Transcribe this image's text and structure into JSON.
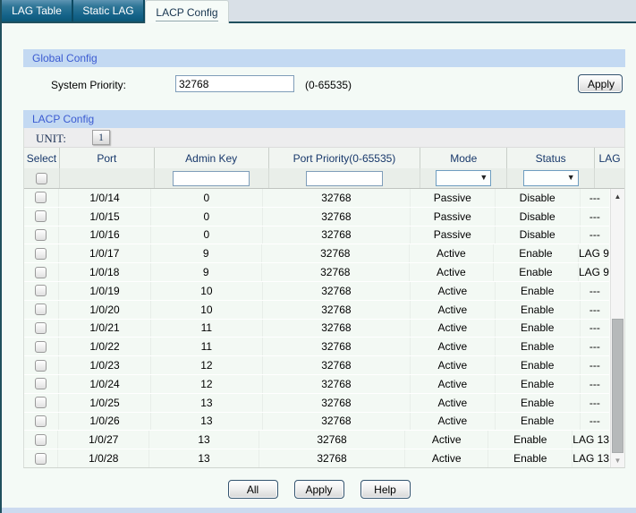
{
  "tabs": [
    {
      "label": "LAG Table",
      "active": false
    },
    {
      "label": "Static LAG",
      "active": false
    },
    {
      "label": "LACP Config",
      "active": true
    }
  ],
  "global_config": {
    "title": "Global Config",
    "system_priority_label": "System Priority:",
    "system_priority_value": "32768",
    "system_priority_hint": "(0-65535)",
    "apply_label": "Apply"
  },
  "lacp_config": {
    "title": "LACP Config",
    "unit_label": "UNIT:",
    "unit_value": "1",
    "columns": [
      "Select",
      "Port",
      "Admin Key",
      "Port Priority(0-65535)",
      "Mode",
      "Status",
      "LAG"
    ],
    "filter": {
      "admin_key": "",
      "port_priority": "",
      "mode": "",
      "status": ""
    },
    "rows": [
      {
        "port": "1/0/14",
        "admin_key": "0",
        "port_priority": "32768",
        "mode": "Passive",
        "status": "Disable",
        "lag": "---"
      },
      {
        "port": "1/0/15",
        "admin_key": "0",
        "port_priority": "32768",
        "mode": "Passive",
        "status": "Disable",
        "lag": "---"
      },
      {
        "port": "1/0/16",
        "admin_key": "0",
        "port_priority": "32768",
        "mode": "Passive",
        "status": "Disable",
        "lag": "---"
      },
      {
        "port": "1/0/17",
        "admin_key": "9",
        "port_priority": "32768",
        "mode": "Active",
        "status": "Enable",
        "lag": "LAG 9"
      },
      {
        "port": "1/0/18",
        "admin_key": "9",
        "port_priority": "32768",
        "mode": "Active",
        "status": "Enable",
        "lag": "LAG 9"
      },
      {
        "port": "1/0/19",
        "admin_key": "10",
        "port_priority": "32768",
        "mode": "Active",
        "status": "Enable",
        "lag": "---"
      },
      {
        "port": "1/0/20",
        "admin_key": "10",
        "port_priority": "32768",
        "mode": "Active",
        "status": "Enable",
        "lag": "---"
      },
      {
        "port": "1/0/21",
        "admin_key": "11",
        "port_priority": "32768",
        "mode": "Active",
        "status": "Enable",
        "lag": "---"
      },
      {
        "port": "1/0/22",
        "admin_key": "11",
        "port_priority": "32768",
        "mode": "Active",
        "status": "Enable",
        "lag": "---"
      },
      {
        "port": "1/0/23",
        "admin_key": "12",
        "port_priority": "32768",
        "mode": "Active",
        "status": "Enable",
        "lag": "---"
      },
      {
        "port": "1/0/24",
        "admin_key": "12",
        "port_priority": "32768",
        "mode": "Active",
        "status": "Enable",
        "lag": "---"
      },
      {
        "port": "1/0/25",
        "admin_key": "13",
        "port_priority": "32768",
        "mode": "Active",
        "status": "Enable",
        "lag": "---"
      },
      {
        "port": "1/0/26",
        "admin_key": "13",
        "port_priority": "32768",
        "mode": "Active",
        "status": "Enable",
        "lag": "---"
      },
      {
        "port": "1/0/27",
        "admin_key": "13",
        "port_priority": "32768",
        "mode": "Active",
        "status": "Enable",
        "lag": "LAG 13"
      },
      {
        "port": "1/0/28",
        "admin_key": "13",
        "port_priority": "32768",
        "mode": "Active",
        "status": "Enable",
        "lag": "LAG 13"
      }
    ]
  },
  "footer": {
    "all_label": "All",
    "apply_label": "Apply",
    "help_label": "Help"
  },
  "icons": {
    "dropdown_arrow": "▼",
    "scroll_up": "▲",
    "scroll_down": "▼"
  },
  "colors": {
    "accent_border": "#20505e",
    "tab_inactive_top": "#5e95b3",
    "tab_inactive_bottom": "#0b5878",
    "section_header_bg": "#c3d9f2",
    "section_header_text": "#3b5bd1",
    "row_bg": "#f3f9f4"
  }
}
